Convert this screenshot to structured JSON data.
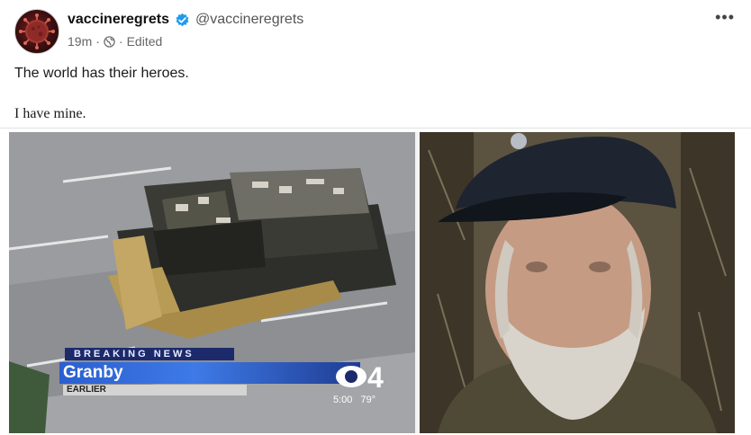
{
  "post": {
    "display_name": "vaccineregrets",
    "handle": "@vaccineregrets",
    "time": "19m",
    "separator": "·",
    "edited_label": "Edited",
    "text_line_1": "The world has their heroes.",
    "text_line_2": "I have mine.",
    "more_label": "•••"
  },
  "icons": {
    "avatar": "virus-avatar",
    "verified": "verified-badge-icon",
    "privacy": "globe-icon",
    "more": "more-options-icon"
  },
  "media": {
    "news_overlay": {
      "banner": "BREAKING NEWS",
      "location": "Granby",
      "subtext": "EARLIER",
      "channel_number": "4",
      "time": "5:00",
      "temperature": "79°"
    }
  },
  "colors": {
    "verified_blue": "#1d9bf0",
    "news_blue": "#2b5fd0",
    "news_navy": "#1c2a6b"
  }
}
